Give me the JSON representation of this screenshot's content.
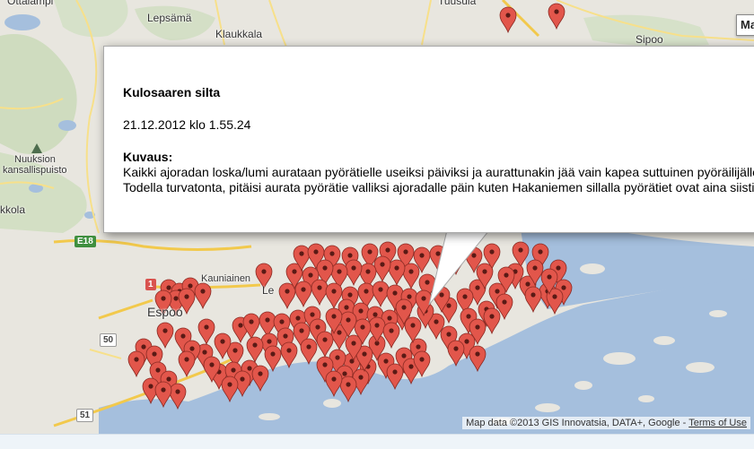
{
  "map": {
    "places": {
      "tuusula": "Tuusula",
      "lepsama": "Lepsämä",
      "klaukkala": "Klaukkala",
      "sipoo": "Sipoo",
      "nuuksio_line1": "Nuuksion",
      "nuuksio_line2": "kansallispuisto",
      "kirkkonummi_partial": "kkola",
      "kauniainen": "Kauniainen",
      "espoo": "Espoo",
      "leppavaara_partial": "Le",
      "top_left_partial": "Ottalampi"
    },
    "road_shields": {
      "e18": "E18",
      "r1": "1",
      "r50": "50",
      "r51": "51"
    },
    "map_type_button": "Ma",
    "marker_color": "#e2564b",
    "water_color": "#a5bfdd",
    "land_color": "#e8e6df"
  },
  "info_window": {
    "title": "Kulosaaren silta",
    "datetime": "21.12.2012 klo 1.55.24",
    "description_heading": "Kuvaus:",
    "description": "Kaikki ajoradan loska/lumi aurataan pyörätielle useiksi päiviksi ja aurattunakin jää vain kapea suttuinen pyöräilijälle. Todella turvatonta, pitäisi aurata pyörätie valliksi ajoradalle päin kuten Hakaniemen sillalla pyörätiet ovat aina siistit."
  },
  "attribution": {
    "text": "Map data ©2013 GIS Innovatsia, DATA+, Google - ",
    "terms_link": "Terms of Use"
  }
}
